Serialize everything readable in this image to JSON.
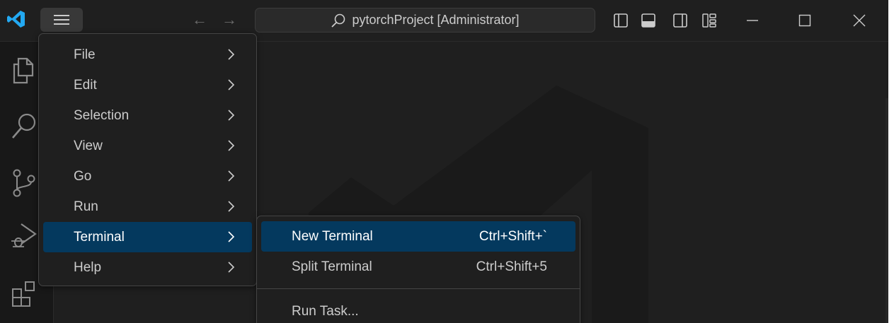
{
  "titlebar": {
    "window_title": "pytorchProject [Administrator]",
    "back_arrow": "←",
    "forward_arrow": "→",
    "layout_icons": [
      "toggle-primary-sidebar-icon",
      "toggle-panel-icon",
      "toggle-secondary-sidebar-icon",
      "customize-layout-icon"
    ],
    "window_controls": [
      "minimize-icon",
      "maximize-icon",
      "close-icon"
    ]
  },
  "activitybar": {
    "icons": [
      "explorer-icon",
      "search-icon",
      "source-control-icon",
      "run-debug-icon",
      "extensions-icon"
    ]
  },
  "main_menu": {
    "items": [
      {
        "label": "File"
      },
      {
        "label": "Edit"
      },
      {
        "label": "Selection"
      },
      {
        "label": "View"
      },
      {
        "label": "Go"
      },
      {
        "label": "Run"
      },
      {
        "label": "Terminal",
        "active": true
      },
      {
        "label": "Help"
      }
    ]
  },
  "terminal_submenu": {
    "items": [
      {
        "label": "New Terminal",
        "shortcut": "Ctrl+Shift+`",
        "active": true
      },
      {
        "label": "Split Terminal",
        "shortcut": "Ctrl+Shift+5"
      },
      {
        "label": "Run Task..."
      }
    ]
  },
  "colors": {
    "background": "#1f1f1f",
    "activity_bar": "#181818",
    "menu_highlight": "#04395e",
    "accent_blue": "#23a9f2"
  }
}
